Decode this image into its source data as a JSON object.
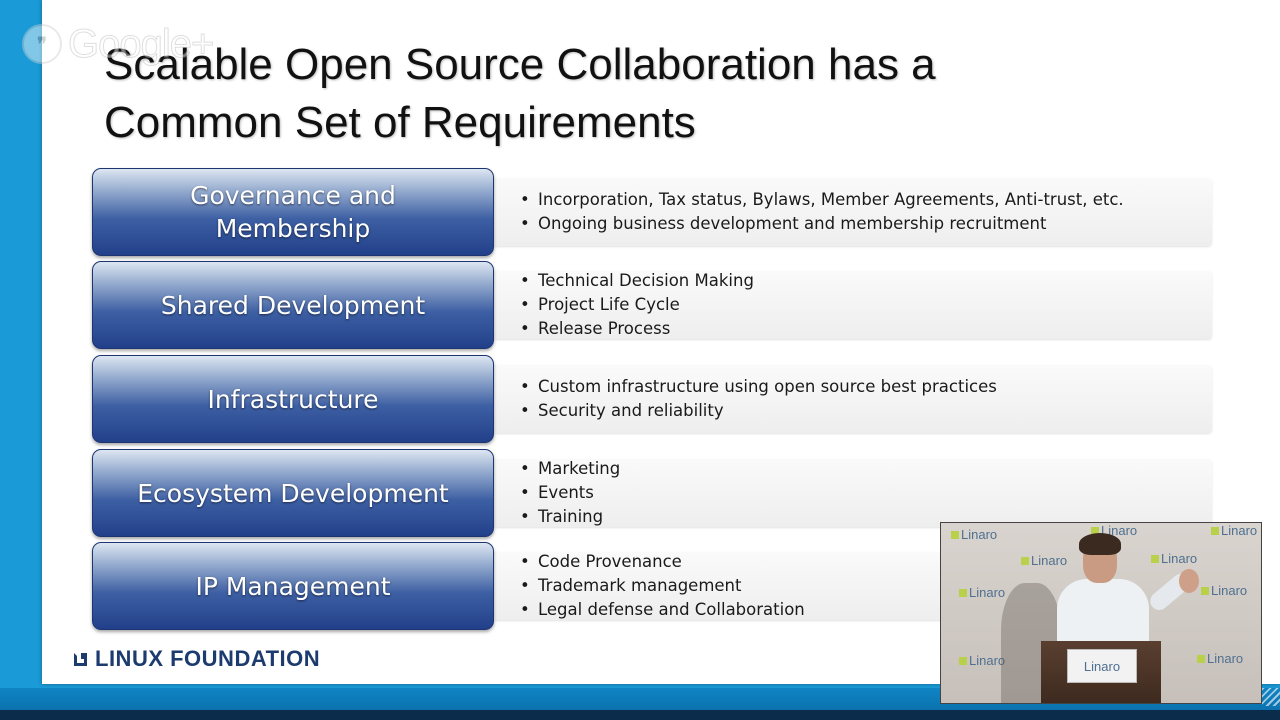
{
  "window": {
    "overlay_logo": "Google+",
    "overlay_icon": "speech-bubble-quote-icon"
  },
  "slide": {
    "title_line1": "Scalable Open Source Collaboration has a",
    "title_line2": "Common Set of Requirements",
    "rows": [
      {
        "category_line1": "Governance and",
        "category_line2": "Membership",
        "bullets": [
          "Incorporation, Tax status, Bylaws, Member Agreements, Anti-trust, etc.",
          "Ongoing business development and membership recruitment"
        ]
      },
      {
        "category_line1": "Shared Development",
        "category_line2": "",
        "bullets": [
          "Technical Decision Making",
          "Project Life Cycle",
          "Release Process"
        ]
      },
      {
        "category_line1": "Infrastructure",
        "category_line2": "",
        "bullets": [
          "Custom infrastructure using open source best practices",
          "Security and reliability"
        ]
      },
      {
        "category_line1": "Ecosystem Development",
        "category_line2": "",
        "bullets": [
          "Marketing",
          "Events",
          "Training"
        ]
      },
      {
        "category_line1": "IP Management",
        "category_line2": "",
        "bullets": [
          "Code Provenance",
          "Trademark management",
          "Legal defense and Collaboration"
        ]
      }
    ],
    "footer_logo": "LINUX FOUNDATION"
  },
  "video": {
    "backdrop_logo": "Linaro",
    "podium_sign": "Linaro"
  },
  "colors": {
    "frame": "#1a9ad6",
    "category_dark": "#22408a",
    "category_light": "#dde6f2",
    "logo_navy": "#1c3b6e"
  }
}
